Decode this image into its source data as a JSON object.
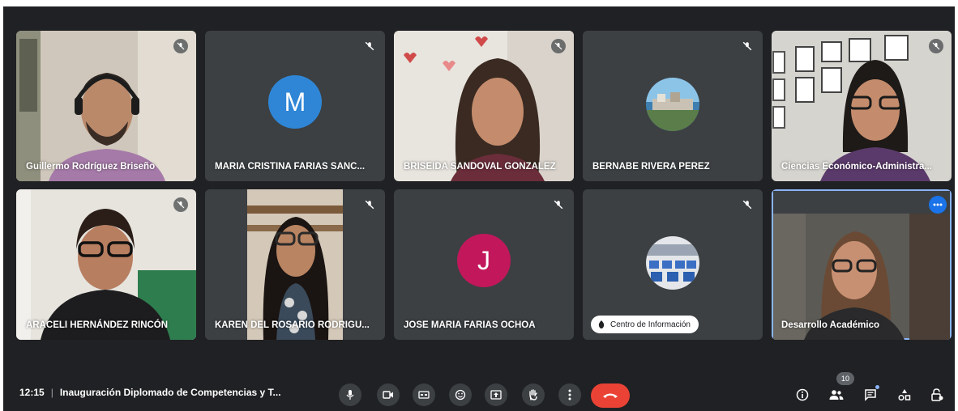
{
  "participants": [
    {
      "name": "Guillermo Rodríguez Briseño"
    },
    {
      "name": "MARIA CRISTINA FARIAS SANC...",
      "initial": "M",
      "avatar_color": "#2f86d6"
    },
    {
      "name": "BRISEIDA SANDOVAL GONZALEZ"
    },
    {
      "name": "BERNABE RIVERA PEREZ"
    },
    {
      "name": "Ciencias Económico-Administra..."
    },
    {
      "name": "ARACELI HERNÁNDEZ RINCÓN"
    },
    {
      "name": "KAREN DEL ROSARIO RODRIGU..."
    },
    {
      "name": "JOSE MARIA FARIAS OCHOA",
      "initial": "J",
      "avatar_color": "#c2185b"
    },
    {
      "name": "Centro de Información"
    },
    {
      "name": "Desarrollo Académico"
    }
  ],
  "meeting": {
    "time": "12:15",
    "separator": "|",
    "title": "Inauguración Diplomado de Competencias y T..."
  },
  "people_count": "10",
  "colors": {
    "background": "#202124",
    "tile": "#3c4043",
    "leave": "#ea4335",
    "active_border": "#8ab4f8"
  },
  "icons": {
    "controls": [
      "microphone-icon",
      "camera-icon",
      "captions-icon",
      "emoji-icon",
      "present-icon",
      "raise-hand-icon",
      "more-options-icon",
      "leave-call-icon"
    ],
    "right": [
      "info-icon",
      "people-icon",
      "chat-icon",
      "activities-icon",
      "host-controls-icon"
    ]
  }
}
